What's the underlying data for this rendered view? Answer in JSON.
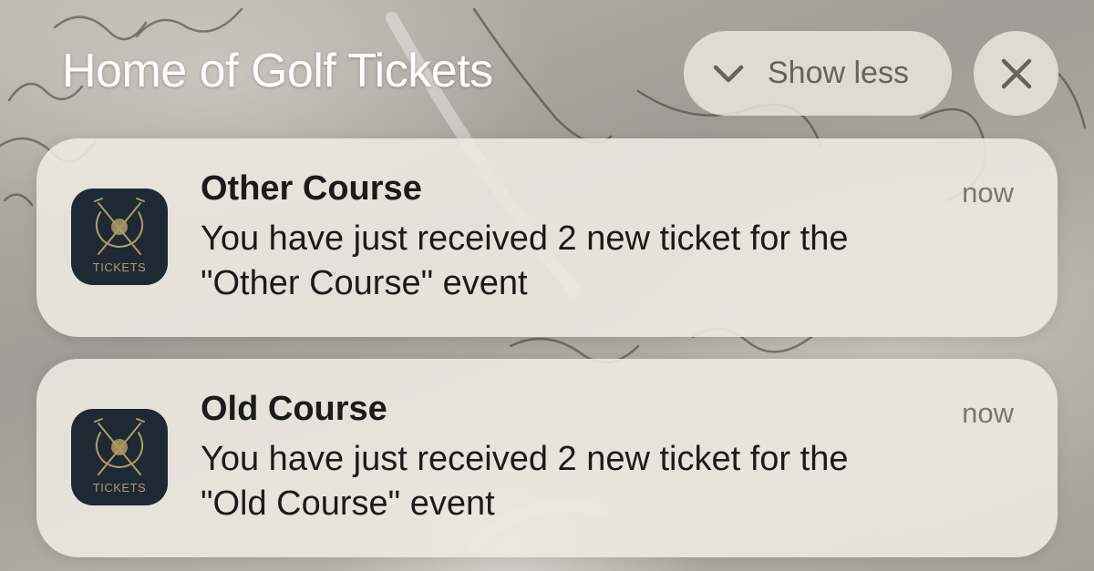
{
  "group": {
    "title": "Home of Golf Tickets",
    "show_less_label": "Show less",
    "show_less_icon": "chevron-down-icon",
    "close_icon": "close-icon"
  },
  "notifications": [
    {
      "app_icon": "golf-tickets-app-icon",
      "app_icon_text": "TICKETS",
      "title": "Other Course",
      "time": "now",
      "body_line1": "You have just received 2 new ticket for the",
      "body_line2": "\"Other Course\" event"
    },
    {
      "app_icon": "golf-tickets-app-icon",
      "app_icon_text": "TICKETS",
      "title": "Old Course",
      "time": "now",
      "body_line1": "You have just received 2 new ticket for the",
      "body_line2": "\"Old Course\" event"
    }
  ],
  "colors": {
    "card_background": "#ece9e1",
    "app_icon_background": "#1d2a34",
    "app_icon_accent": "#b49a66",
    "title_text": "#1b1b1b",
    "secondary_text": "#7a7770"
  }
}
